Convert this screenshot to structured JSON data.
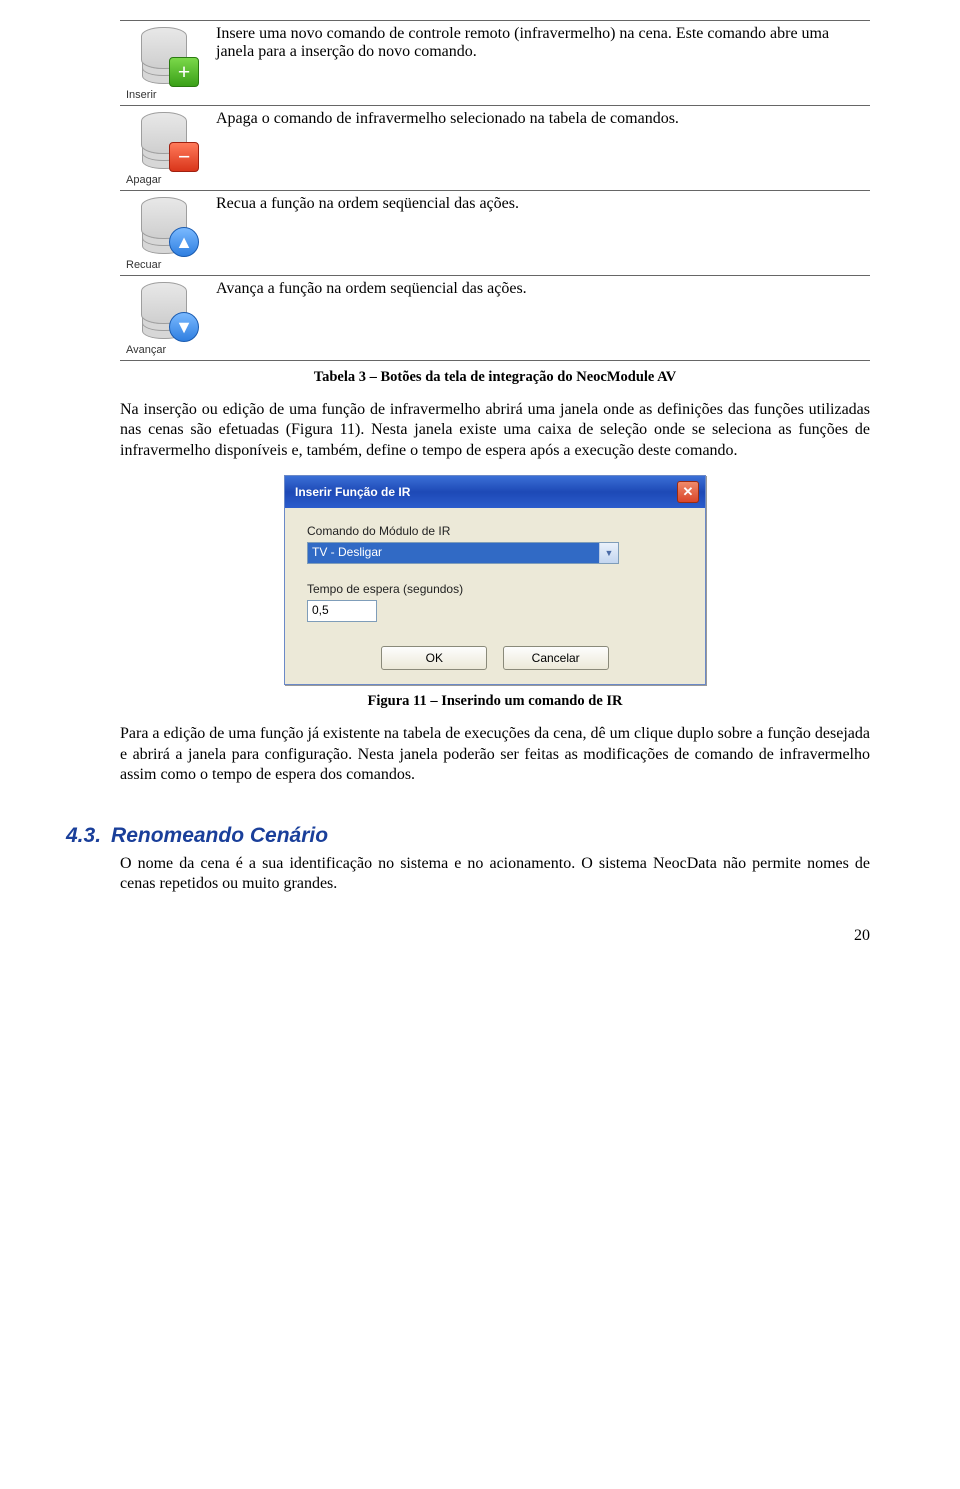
{
  "buttons_table": {
    "rows": [
      {
        "icon_label": "Inserir",
        "desc": "Insere uma novo comando de controle remoto (infravermelho) na cena. Este comando abre uma janela para a inserção do novo comando."
      },
      {
        "icon_label": "Apagar",
        "desc": "Apaga o comando de infravermelho selecionado na tabela de comandos."
      },
      {
        "icon_label": "Recuar",
        "desc": "Recua a função na ordem seqüencial das ações."
      },
      {
        "icon_label": "Avançar",
        "desc": "Avança a função na ordem seqüencial das ações."
      }
    ],
    "caption": "Tabela 3 – Botões da tela de integração do NeocModule AV"
  },
  "para1": "Na inserção ou edição de uma função de infravermelho abrirá uma janela onde as definições das funções utilizadas nas cenas são efetuadas (Figura 11). Nesta janela existe uma caixa de seleção onde se seleciona as funções de infravermelho disponíveis e, também, define o tempo de espera após a execução deste comando.",
  "dialog": {
    "title": "Inserir Função de IR",
    "label_cmd": "Comando do Módulo de IR",
    "combo_value": "TV - Desligar",
    "label_delay": "Tempo de espera (segundos)",
    "delay_value": "0,5",
    "ok": "OK",
    "cancel": "Cancelar"
  },
  "figure_caption": "Figura 11 – Inserindo um comando de IR",
  "para2": "Para a edição de uma função já existente na tabela de execuções da cena, dê um clique duplo sobre a função desejada e abrirá a janela para configuração. Nesta janela poderão ser feitas as modificações de comando de infravermelho assim como o tempo de espera dos comandos.",
  "section": {
    "num": "4.3.",
    "title": "Renomeando Cenário",
    "body": "O nome da cena é a sua identificação no sistema e no acionamento. O sistema NeocData não permite nomes de cenas repetidos ou muito grandes."
  },
  "page_number": "20"
}
